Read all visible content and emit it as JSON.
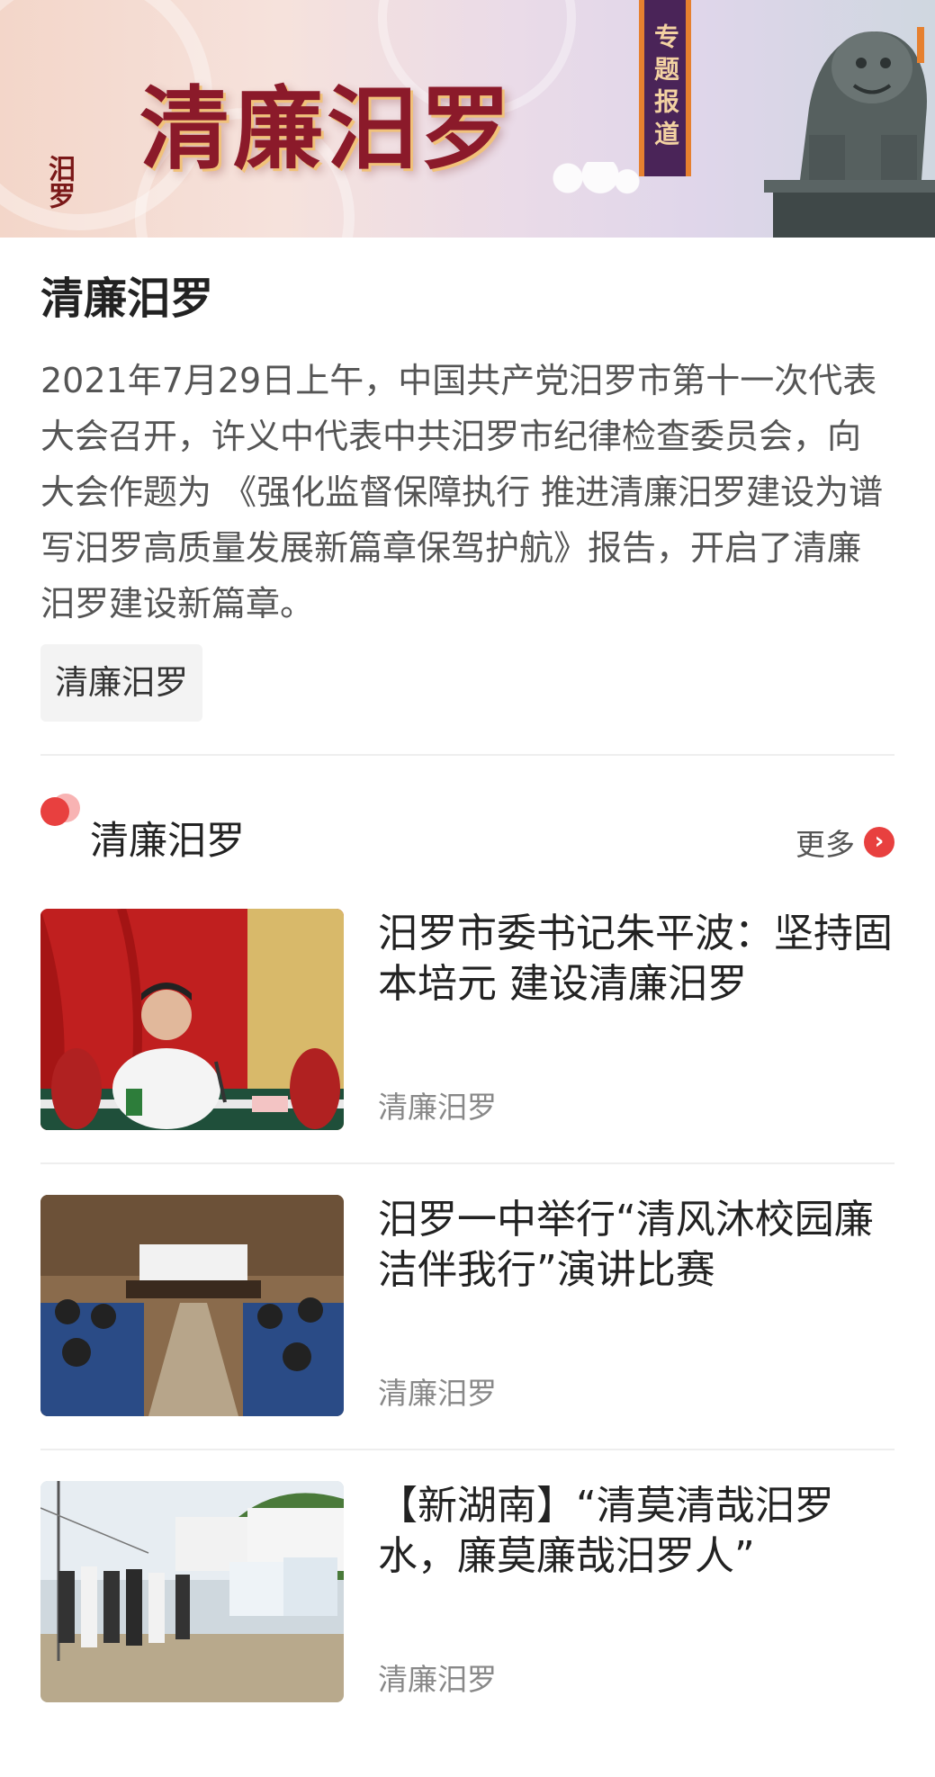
{
  "banner": {
    "title": "清廉汨罗",
    "tag": "专题报道",
    "logo_text": "汨罗"
  },
  "intro": {
    "title": "清廉汨罗",
    "body": "2021年7月29日上午，中国共产党汨罗市第十一次代表大会召开，许义中代表中共汨罗市纪律检查委员会，向大会作题为 《强化监督保障执行 推进清廉汨罗建设为谱写汨罗高质量发展新篇章保驾护航》报告，开启了清廉汨罗建设新篇章。",
    "tag": "清廉汨罗"
  },
  "section": {
    "title": "清廉汨罗",
    "more_label": "更多",
    "more_icon": "chevron-right-icon",
    "accent_color": "#e8403f"
  },
  "news": [
    {
      "title": "汨罗市委书记朱平波：坚持固本培元 建设清廉汨罗",
      "source": "清廉汨罗"
    },
    {
      "title": "汨罗一中举行“清风沐校园廉洁伴我行”演讲比赛",
      "source": "清廉汨罗"
    },
    {
      "title": "【新湖南】“清莫清哉汨罗水，廉莫廉哉汨罗人”",
      "source": "清廉汨罗"
    }
  ]
}
